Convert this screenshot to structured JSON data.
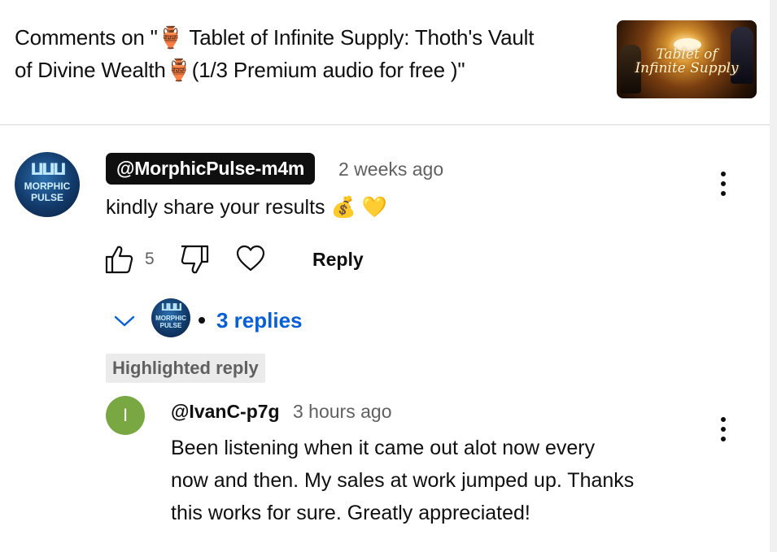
{
  "header": {
    "title_line1": "Comments on \"🏺 Tablet of Infinite Supply: Thoth's Vault",
    "title_line2": "of Divine Wealth🏺(1/3 Premium audio for free )\"",
    "thumbnail_text_line1": "Tablet of",
    "thumbnail_text_line2": "Infinite Supply"
  },
  "comment": {
    "avatar_line1": "MORPHIC",
    "avatar_line2": "PULSE",
    "author": "@MorphicPulse-m4m",
    "time": "2 weeks ago",
    "text": "kindly share your results 💰 💛",
    "like_count": "5",
    "reply_label": "Reply",
    "menu_icon": "more-vert-icon"
  },
  "replies_toggle": {
    "separator": "•",
    "label": "3 replies",
    "accent_color": "#065fd4"
  },
  "highlighted_reply": {
    "badge": "Highlighted reply",
    "avatar_letter": "I",
    "avatar_color": "#79a742",
    "author": "@IvanC-p7g",
    "time": "3 hours ago",
    "text_line1": "Been listening when it came out alot now every",
    "text_line2": "now and then. My sales at work jumped up. Thanks",
    "text_line3": "this works for sure. Greatly appreciated!",
    "menu_icon": "more-vert-icon"
  }
}
